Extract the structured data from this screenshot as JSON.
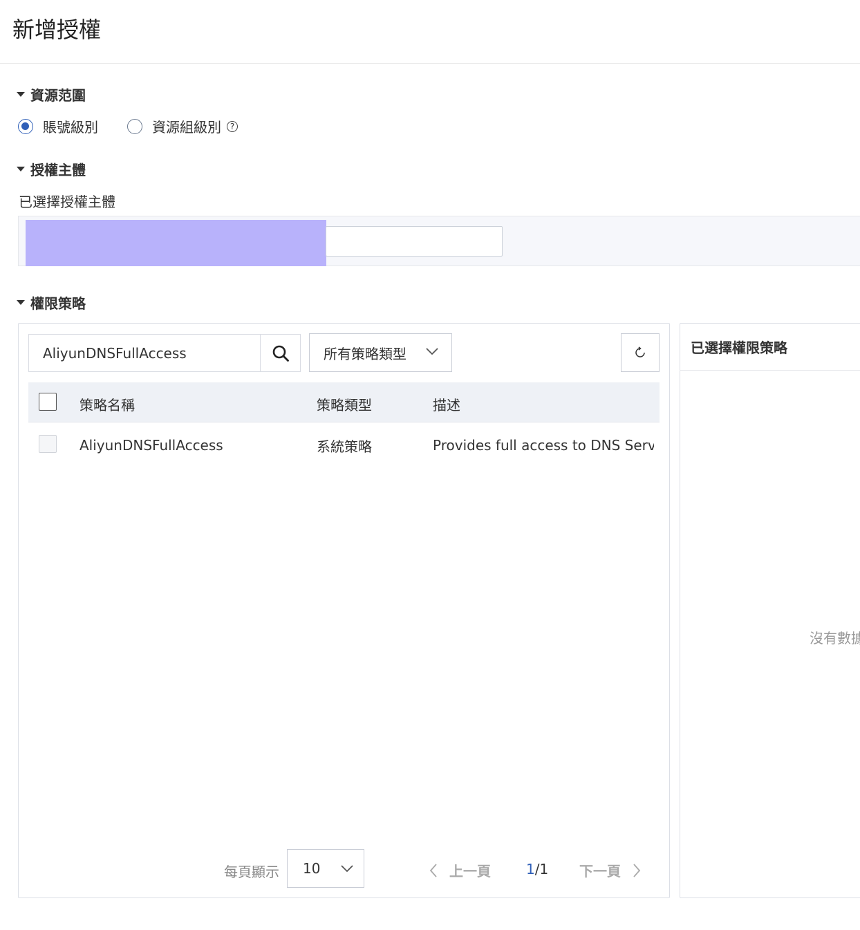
{
  "page": {
    "title": "新增授權"
  },
  "resource_scope": {
    "heading": "資源范圍",
    "options": [
      {
        "label": "賬號級別",
        "selected": true
      },
      {
        "label": "資源組級別",
        "selected": false
      }
    ],
    "help_glyph": "?"
  },
  "principal": {
    "heading": "授權主體",
    "selected_label": "已選擇授權主體"
  },
  "policies": {
    "heading": "權限策略",
    "search": {
      "value": "AliyunDNSFullAccess"
    },
    "type_filter": {
      "selected": "所有策略類型"
    },
    "table": {
      "headers": [
        "策略名稱",
        "策略類型",
        "描述"
      ],
      "rows": [
        {
          "name": "AliyunDNSFullAccess",
          "type": "系統策略",
          "description": "Provides full access to DNS Serv..."
        }
      ]
    },
    "pagination": {
      "per_page_label": "每頁顯示",
      "per_page_value": "10",
      "prev_label": "上一頁",
      "current_page": "1",
      "total_pages": "/1",
      "next_label": "下一頁"
    }
  },
  "selected_policies": {
    "heading": "已選擇權限策略",
    "empty_text": "沒有數據"
  },
  "colors": {
    "accent": "#2f5fb8",
    "redaction": "#b8b2fb"
  }
}
